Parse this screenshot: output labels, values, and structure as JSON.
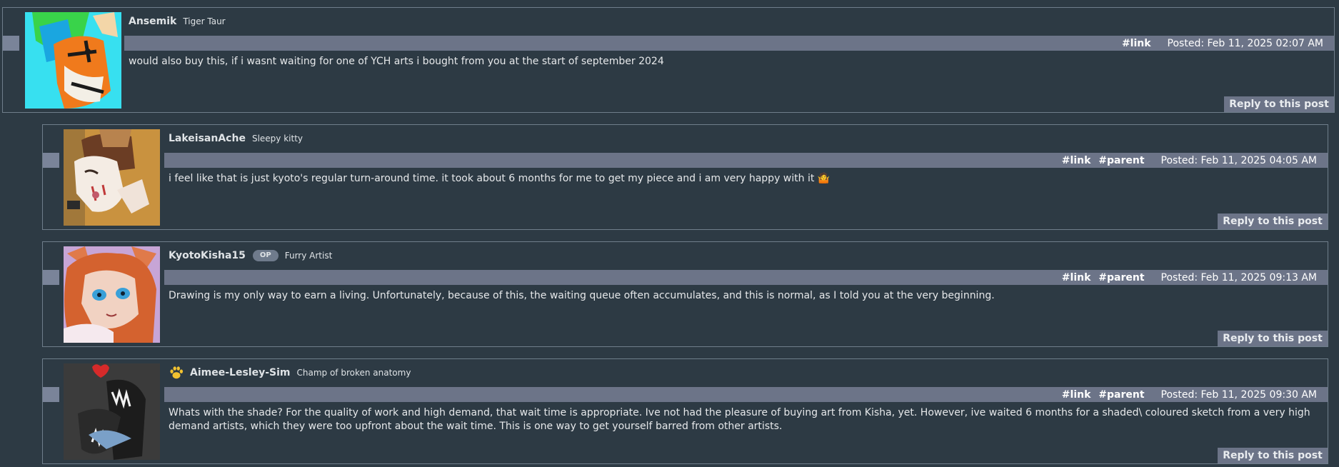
{
  "comments": [
    {
      "username": "Ansemik",
      "user_title": "Tiger Taur",
      "is_op": false,
      "links": [
        "#link"
      ],
      "posted": "Posted: Feb 11, 2025 02:07 AM",
      "body": "would also buy this, if i wasnt waiting for one of YCH arts i bought from you at the start of september 2024",
      "reply_label": "Reply to this post"
    },
    {
      "username": "LakeisanAche",
      "user_title": "Sleepy kitty",
      "is_op": false,
      "links": [
        "#link",
        "#parent"
      ],
      "posted": "Posted: Feb 11, 2025 04:05 AM",
      "body": "i feel like that is just kyoto's regular turn-around time. it took about 6 months for me to get my piece and i am very happy with it 🤷",
      "reply_label": "Reply to this post"
    },
    {
      "username": "KyotoKisha15",
      "user_title": "Furry Artist",
      "is_op": true,
      "op_label": "OP",
      "links": [
        "#link",
        "#parent"
      ],
      "posted": "Posted: Feb 11, 2025 09:13 AM",
      "body": "Drawing is my only way to earn a living. Unfortunately, because of this, the waiting queue often accumulates, and this is normal, as I told you at the very beginning.",
      "reply_label": "Reply to this post"
    },
    {
      "username": "Aimee-Lesley-Sim",
      "user_title": "Champ of broken anatomy",
      "is_op": false,
      "links": [
        "#link",
        "#parent"
      ],
      "posted": "Posted: Feb 11, 2025 09:30 AM",
      "body": "Whats with the shade? For the quality of work and high demand, that wait time is appropriate. Ive not had the pleasure of buying art from Kisha, yet. However, ive waited 6 months for a shaded\\ coloured sketch from a very high demand artists, which they were too upfront about the wait time. This is one way to get yourself barred from other artists.",
      "reply_label": "Reply to this post"
    }
  ],
  "colors": {
    "background": "#2d3a44",
    "header_bar": "#6c7488",
    "border": "#6f7e8b",
    "paw_icon": "#f2c230"
  }
}
